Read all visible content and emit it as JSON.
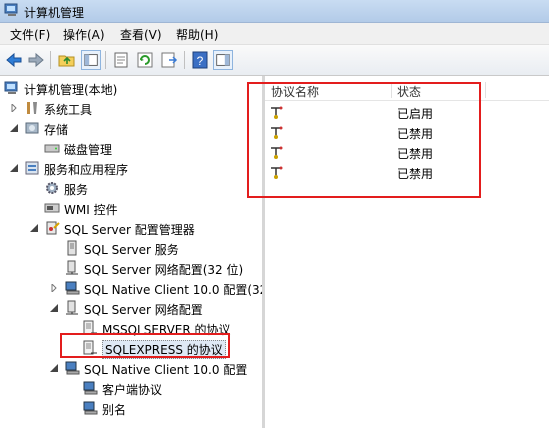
{
  "window": {
    "title": "计算机管理"
  },
  "menu": {
    "items": [
      "文件(F)",
      "操作(A)",
      "查看(V)",
      "帮助(H)"
    ]
  },
  "tree": {
    "root": "计算机管理(本地)",
    "system_tools": "系统工具",
    "storage": "存储",
    "disk_mgmt": "磁盘管理",
    "services_apps": "服务和应用程序",
    "services": "服务",
    "wmi": "WMI 控件",
    "sql_cfg": "SQL Server 配置管理器",
    "sql_services": "SQL Server 服务",
    "sql_net32": "SQL Server 网络配置(32 位)",
    "native32": "SQL Native Client 10.0 配置(32",
    "sql_net": "SQL Server 网络配置",
    "mssqlserver": "MSSQLSERVER 的协议",
    "sqlexpress": "SQLEXPRESS 的协议",
    "native": "SQL Native Client 10.0 配置",
    "client_proto": "客户端协议",
    "aliases": "别名"
  },
  "list": {
    "columns": {
      "name": "协议名称",
      "status": "状态"
    },
    "rows": [
      {
        "name": "",
        "status": "已启用"
      },
      {
        "name": "",
        "status": "已禁用"
      },
      {
        "name": "",
        "status": "已禁用"
      },
      {
        "name": "",
        "status": "已禁用"
      }
    ]
  },
  "colors": {
    "highlight": "#e31d1d"
  }
}
